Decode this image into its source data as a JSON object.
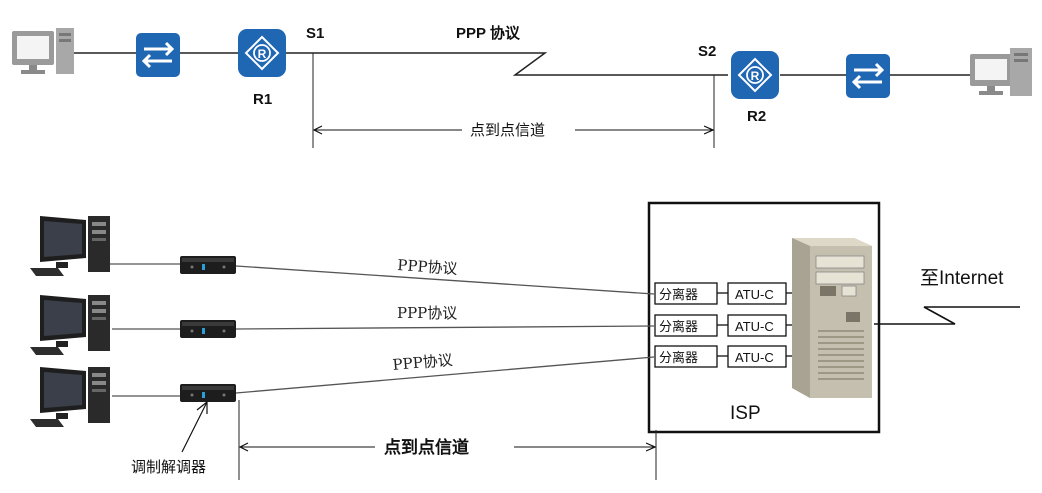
{
  "top": {
    "s1_label": "S1",
    "s2_label": "S2",
    "r1_label": "R1",
    "r2_label": "R2",
    "ppp_label": "PPP 协议",
    "channel_label": "点到点信道"
  },
  "bottom": {
    "ppp_labels": [
      "PPP协议",
      "PPP协议",
      "PPP协议"
    ],
    "splitter_labels": [
      "分离器",
      "分离器",
      "分离器"
    ],
    "atu_labels": [
      "ATU-C",
      "ATU-C",
      "ATU-C"
    ],
    "isp_label": "ISP",
    "internet_label": "至Internet",
    "modem_label": "调制解调器",
    "channel_label": "点到点信道"
  },
  "colors": {
    "device_blue": "#1f66b3",
    "line": "#555555",
    "monitor_gray": "#8a8a8a"
  },
  "icons": [
    "computer-icon",
    "switch-icon",
    "router-icon",
    "server-icon",
    "modem-icon"
  ]
}
